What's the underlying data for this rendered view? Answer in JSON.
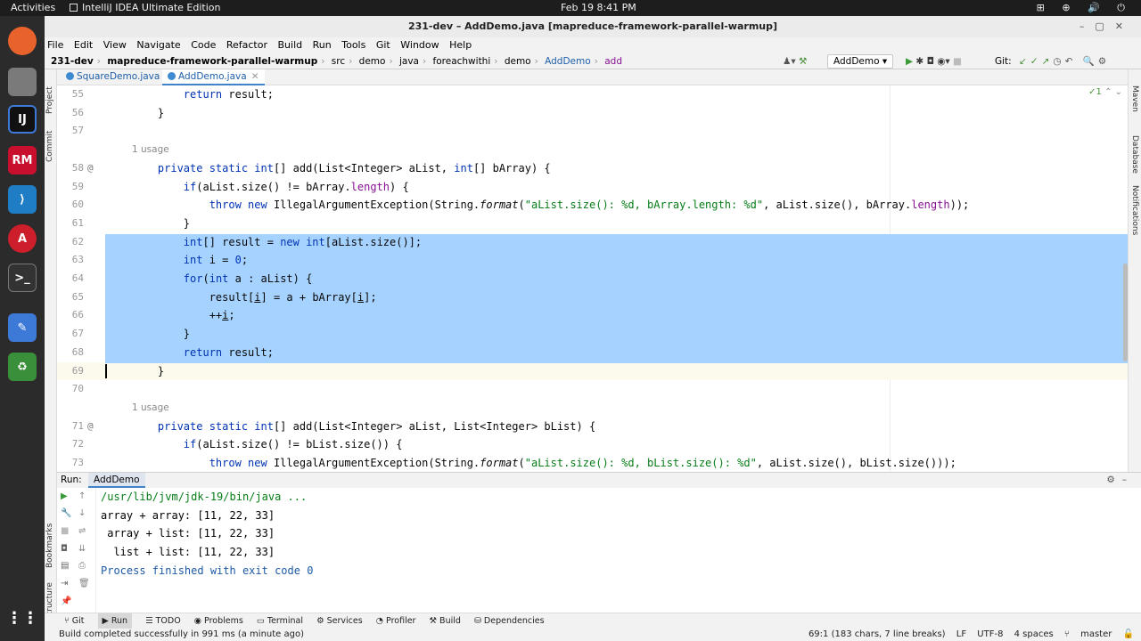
{
  "os": {
    "activities": "Activities",
    "app_name": "IntelliJ IDEA Ultimate Edition",
    "clock": "Feb 19  8:41 PM"
  },
  "window": {
    "title": "231-dev – AddDemo.java [mapreduce-framework-parallel-warmup]"
  },
  "menu": [
    "File",
    "Edit",
    "View",
    "Navigate",
    "Code",
    "Refactor",
    "Build",
    "Run",
    "Tools",
    "Git",
    "Window",
    "Help"
  ],
  "breadcrumbs": [
    "231-dev",
    "mapreduce-framework-parallel-warmup",
    "src",
    "demo",
    "java",
    "foreachwithi",
    "demo",
    "AddDemo",
    "add"
  ],
  "toolbar": {
    "run_config": "AddDemo",
    "git_label": "Git:"
  },
  "tabs": [
    {
      "label": "SquareDemo.java"
    },
    {
      "label": "AddDemo.java"
    }
  ],
  "editor": {
    "inspection_count": "1",
    "lines": [
      {
        "num": "55",
        "text": "        return result;"
      },
      {
        "num": "56",
        "text": "    }"
      },
      {
        "num": "57",
        "text": ""
      },
      {
        "usage": "1 usage"
      },
      {
        "num": "58",
        "text": "    private static int[] add(List<Integer> aList, int[] bArray) {"
      },
      {
        "num": "59",
        "text": "        if(aList.size() != bArray.length) {"
      },
      {
        "num": "60",
        "text": "            throw new IllegalArgumentException(String.format(\"aList.size(): %d, bArray.length: %d\", aList.size(), bArray.length));"
      },
      {
        "num": "61",
        "text": "        }"
      },
      {
        "num": "62",
        "text": "        int[] result = new int[aList.size()];"
      },
      {
        "num": "63",
        "text": "        int i = 0;"
      },
      {
        "num": "64",
        "text": "        for(int a : aList) {"
      },
      {
        "num": "65",
        "text": "            result[i] = a + bArray[i];"
      },
      {
        "num": "66",
        "text": "            ++i;"
      },
      {
        "num": "67",
        "text": "        }"
      },
      {
        "num": "68",
        "text": "        return result;"
      },
      {
        "num": "69",
        "text": "    }"
      },
      {
        "num": "70",
        "text": ""
      },
      {
        "usage": "1 usage"
      },
      {
        "num": "71",
        "text": "    private static int[] add(List<Integer> aList, List<Integer> bList) {"
      },
      {
        "num": "72",
        "text": "        if(aList.size() != bList.size()) {"
      },
      {
        "num": "73",
        "text": "            throw new IllegalArgumentException(String.format(\"aList.size(): %d, bList.size(): %d\", aList.size(), bList.size()));"
      }
    ]
  },
  "run_panel": {
    "label": "Run:",
    "tab": "AddDemo",
    "console": [
      "/usr/lib/jvm/jdk-19/bin/java ...",
      "array + array: [11, 22, 33]",
      " array + list: [11, 22, 33]",
      "  list + list: [11, 22, 33]",
      "",
      "Process finished with exit code 0"
    ]
  },
  "side_labels": {
    "project": "Project",
    "commit": "Commit",
    "bookmarks": "Bookmarks",
    "structure": "Structure",
    "maven": "Maven",
    "database": "Database",
    "notifications": "Notifications"
  },
  "bottom_tabs": [
    "Git",
    "Run",
    "TODO",
    "Problems",
    "Terminal",
    "Services",
    "Profiler",
    "Build",
    "Dependencies"
  ],
  "status": {
    "message": "Build completed successfully in 991 ms (a minute ago)",
    "position": "69:1 (183 chars, 7 line breaks)",
    "line_sep": "LF",
    "encoding": "UTF-8",
    "indent": "4 spaces",
    "branch": "master"
  }
}
